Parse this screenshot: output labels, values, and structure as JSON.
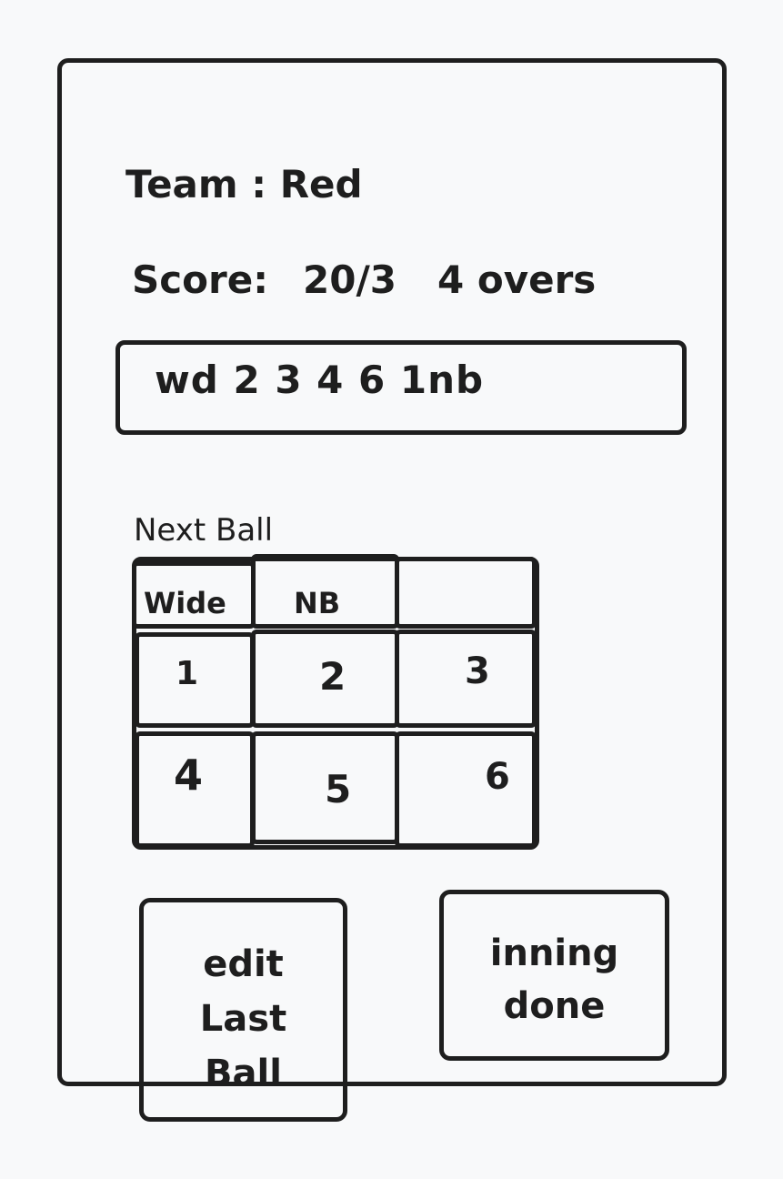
{
  "team_line": "Team : Red",
  "score": {
    "label": "Score:",
    "value": "20/3",
    "overs": "4 overs"
  },
  "recent_balls": "wd 2 3 4 6 1nb",
  "next_ball_label": "Next Ball",
  "extras": [
    "Wide",
    "NB",
    ""
  ],
  "runs_row1": [
    "1",
    "2",
    "3"
  ],
  "runs_row2": [
    "4",
    "5",
    "6"
  ],
  "buttons": {
    "edit_last_ball": [
      "edit",
      "Last",
      "Ball"
    ],
    "inning_done": [
      "inning",
      "done"
    ]
  }
}
